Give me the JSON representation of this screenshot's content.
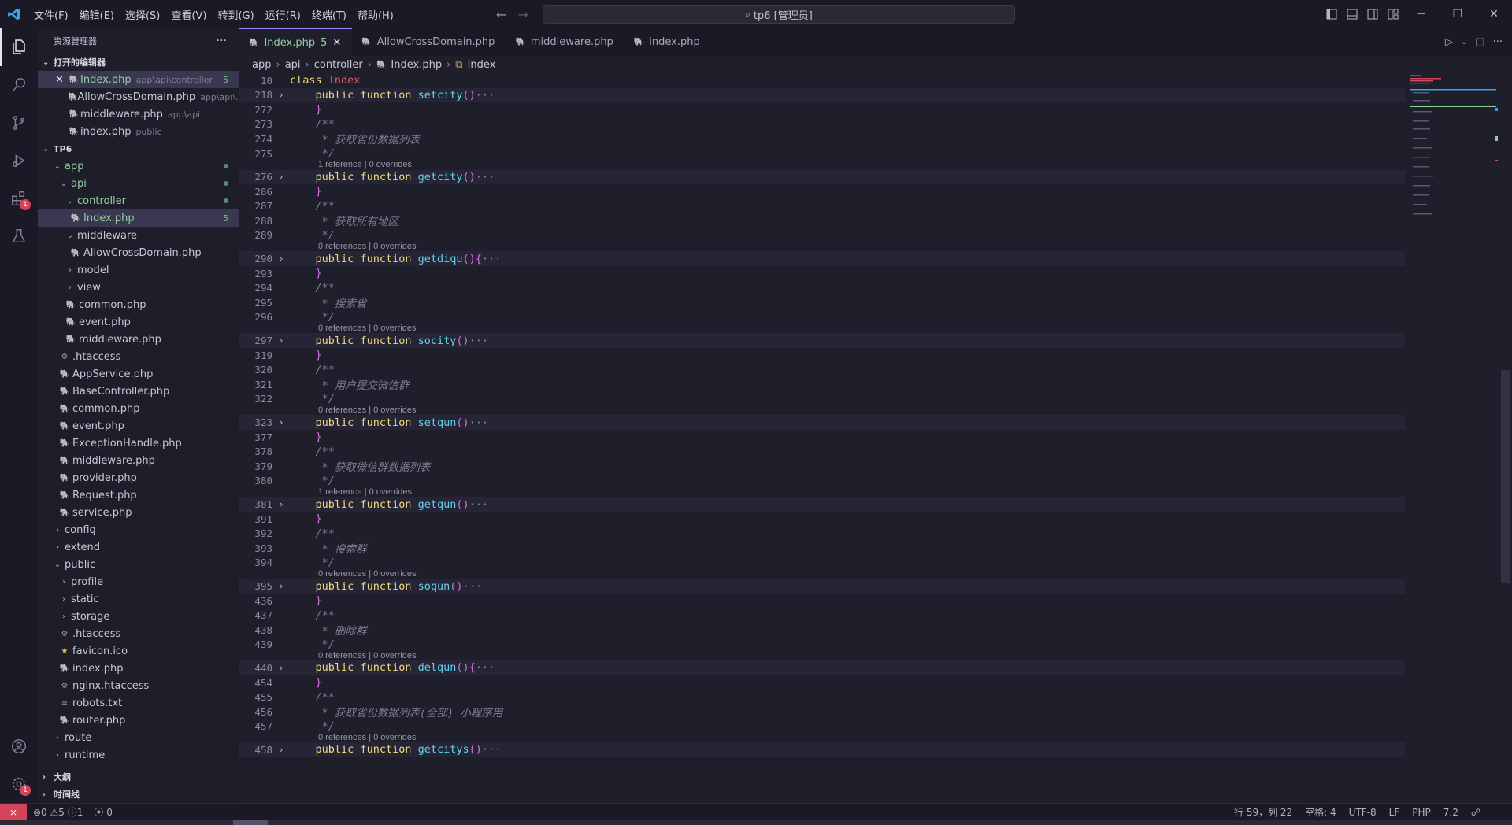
{
  "titlebar": {
    "menu": [
      "文件(F)",
      "编辑(E)",
      "选择(S)",
      "查看(V)",
      "转到(G)",
      "运行(R)",
      "终端(T)",
      "帮助(H)"
    ],
    "search": "tp6 [管理员]"
  },
  "explorer": {
    "title": "资源管理器",
    "open_editors_label": "打开的编辑器",
    "open_editors": [
      {
        "name": "Index.php",
        "desc": "app\\api\\controller",
        "count": "5"
      },
      {
        "name": "AllowCrossDomain.php",
        "desc": "app\\api\\..."
      },
      {
        "name": "middleware.php",
        "desc": "app\\api"
      },
      {
        "name": "index.php",
        "desc": "public"
      }
    ],
    "project_label": "TP6",
    "tree": {
      "app": "app",
      "api": "api",
      "controller": "controller",
      "index_php": "Index.php",
      "index_count": "5",
      "middleware_dir": "middleware",
      "allow": "AllowCrossDomain.php",
      "model": "model",
      "view": "view",
      "api_common": "common.php",
      "api_event": "event.php",
      "api_middleware": "middleware.php",
      "htaccess": ".htaccess",
      "appservice": "AppService.php",
      "basecontroller": "BaseController.php",
      "common": "common.php",
      "event": "event.php",
      "exception": "ExceptionHandle.php",
      "middleware": "middleware.php",
      "provider": "provider.php",
      "request": "Request.php",
      "service": "service.php",
      "config": "config",
      "extend": "extend",
      "public": "public",
      "profile": "profile",
      "static": "static",
      "storage": "storage",
      "pub_htaccess": ".htaccess",
      "favicon": "favicon.ico",
      "pub_index": "index.php",
      "nginx": "nginx.htaccess",
      "robots": "robots.txt",
      "router": "router.php",
      "route": "route",
      "runtime": "runtime"
    },
    "outline_label": "大纲",
    "timeline_label": "时间线"
  },
  "tabs": [
    {
      "label": "Index.php",
      "count": "5"
    },
    {
      "label": "AllowCrossDomain.php"
    },
    {
      "label": "middleware.php"
    },
    {
      "label": "index.php"
    }
  ],
  "breadcrumb": [
    "app",
    "api",
    "controller",
    "Index.php",
    "Index"
  ],
  "code": {
    "lines": [
      {
        "n": "10",
        "t": "class",
        "kw": "class",
        "cls": "Index"
      },
      {
        "n": "218",
        "fold": true,
        "fn": "setcity",
        "tail": "()",
        "ell": "···"
      },
      {
        "n": "272",
        "t": "}"
      },
      {
        "n": "273",
        "c": "/**"
      },
      {
        "n": "274",
        "c": " * 获取省份数据列表"
      },
      {
        "n": "275",
        "c": " */"
      },
      {
        "n": "276",
        "fold": true,
        "fn": "getcity",
        "tail": "()",
        "ell": "···"
      },
      {
        "n": "286",
        "t": "}"
      },
      {
        "n": "287",
        "c": "/**"
      },
      {
        "n": "288",
        "c": " * 获取所有地区"
      },
      {
        "n": "289",
        "c": " */"
      },
      {
        "n": "290",
        "fold": true,
        "fn": "getdiqu",
        "tail": "(){",
        "ell": "···"
      },
      {
        "n": "293",
        "t": "}"
      },
      {
        "n": "294",
        "c": "/**"
      },
      {
        "n": "295",
        "c": " * 搜索省"
      },
      {
        "n": "296",
        "c": " */"
      },
      {
        "n": "297",
        "fold": true,
        "fn": "socity",
        "tail": "()",
        "ell": "···"
      },
      {
        "n": "319",
        "t": "}"
      },
      {
        "n": "320",
        "c": "/**"
      },
      {
        "n": "321",
        "c": " * 用户提交微信群"
      },
      {
        "n": "322",
        "c": " */"
      },
      {
        "n": "323",
        "fold": true,
        "fn": "setqun",
        "tail": "()",
        "ell": "···"
      },
      {
        "n": "377",
        "t": "}"
      },
      {
        "n": "378",
        "c": "/**"
      },
      {
        "n": "379",
        "c": " * 获取微信群数据列表"
      },
      {
        "n": "380",
        "c": " */"
      },
      {
        "n": "381",
        "fold": true,
        "fn": "getqun",
        "tail": "()",
        "ell": "···"
      },
      {
        "n": "391",
        "t": "}"
      },
      {
        "n": "392",
        "c": "/**"
      },
      {
        "n": "393",
        "c": " * 搜索群"
      },
      {
        "n": "394",
        "c": " */"
      },
      {
        "n": "395",
        "fold": true,
        "fn": "soqun",
        "tail": "()",
        "ell": "···"
      },
      {
        "n": "436",
        "t": "}"
      },
      {
        "n": "437",
        "c": "/**"
      },
      {
        "n": "438",
        "c": " * 删除群"
      },
      {
        "n": "439",
        "c": " */"
      },
      {
        "n": "440",
        "fold": true,
        "fn": "delqun",
        "tail": "(){",
        "ell": "···"
      },
      {
        "n": "454",
        "t": "}"
      },
      {
        "n": "455",
        "c": "/**"
      },
      {
        "n": "456",
        "c": " * 获取省份数据列表(全部) 小程序用"
      },
      {
        "n": "457",
        "c": " */"
      },
      {
        "n": "458",
        "fold": true,
        "fn": "getcitys",
        "tail": "()",
        "ell": "···"
      }
    ],
    "lenses": [
      {
        "before": 6,
        "text": "1 reference | 0 overrides"
      },
      {
        "before": 11,
        "text": "0 references | 0 overrides"
      },
      {
        "before": 16,
        "text": "0 references | 0 overrides"
      },
      {
        "before": 21,
        "text": "0 references | 0 overrides"
      },
      {
        "before": 26,
        "text": "1 reference | 0 overrides"
      },
      {
        "before": 31,
        "text": "0 references | 0 overrides"
      },
      {
        "before": 36,
        "text": "0 references | 0 overrides"
      },
      {
        "before": 41,
        "text": "0 references | 0 overrides"
      }
    ],
    "public_kw": "public",
    "function_kw": "function"
  },
  "statusbar": {
    "problems": "⊗0 ⚠5 ⓘ1",
    "ports": "0",
    "position": "行 59，列 22",
    "spaces": "空格: 4",
    "encoding": "UTF-8",
    "eol": "LF",
    "language": "PHP",
    "version": "7.2"
  },
  "colors": {
    "accent": "#a27cf5",
    "error": "#d4455b",
    "modified": "#8fd19e"
  }
}
